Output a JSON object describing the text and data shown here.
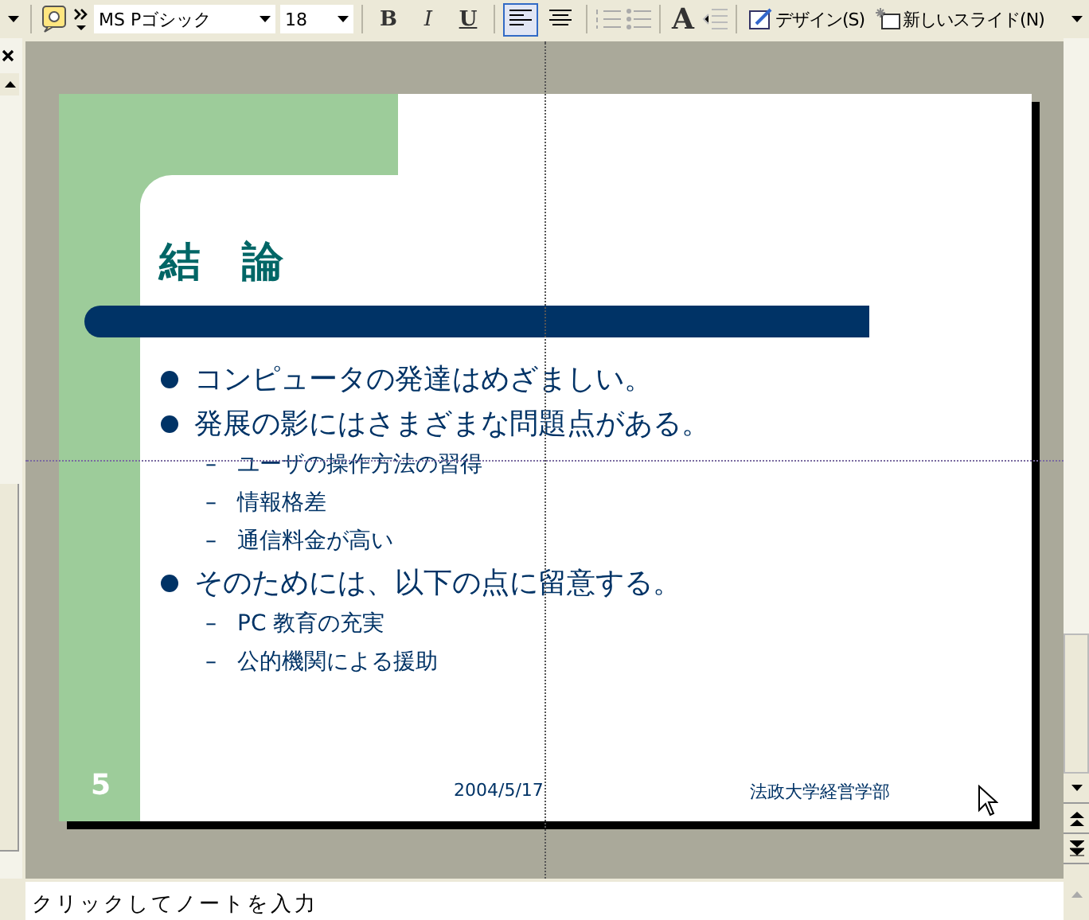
{
  "toolbar": {
    "font_name": "MS Pゴシック",
    "font_size": "18",
    "format_buttons": [
      {
        "label": "B",
        "kind": "bold"
      },
      {
        "label": "I",
        "kind": "italic"
      },
      {
        "label": "U",
        "kind": "underline"
      }
    ],
    "align_buttons": [
      {
        "kind": "left",
        "selected": true
      },
      {
        "kind": "center",
        "selected": false
      }
    ],
    "grow_font": "A",
    "design": "デザイン(S)",
    "new_slide": "新しいスライド(N)"
  },
  "slide": {
    "title": "結　論",
    "bullets": [
      {
        "text": "コンピュータの発達はめざましい。"
      },
      {
        "text": "発展の影にはさまざまな問題点がある。",
        "children": [
          {
            "text": "ユーザの操作方法の習得"
          },
          {
            "text": "情報格差"
          },
          {
            "text": "通信料金が高い"
          }
        ]
      },
      {
        "text": "そのためには、以下の点に留意する。",
        "children": [
          {
            "text": "PC 教育の充実"
          },
          {
            "text": "公的機関による援助"
          }
        ]
      }
    ],
    "sub_marker": "–",
    "number": "5",
    "date": "2004/5/17",
    "organization": "法政大学経営学部"
  },
  "notes": {
    "placeholder": "クリックしてノートを入力"
  }
}
